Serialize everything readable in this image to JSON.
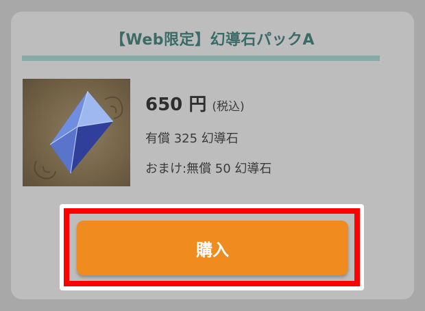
{
  "product": {
    "title": "【Web限定】幻導石パックA",
    "price": "650 円",
    "tax_note": "(税込)",
    "paid_line": "有償 325 幻導石",
    "bonus_line": "おまけ:無償 50 幻導石",
    "image_icon": "crystal-gem-icon"
  },
  "actions": {
    "buy_label": "購入"
  },
  "colors": {
    "title": "#3a6b66",
    "rule": "#86aba7",
    "button": "#f08b20",
    "highlight": "#ff0000"
  }
}
